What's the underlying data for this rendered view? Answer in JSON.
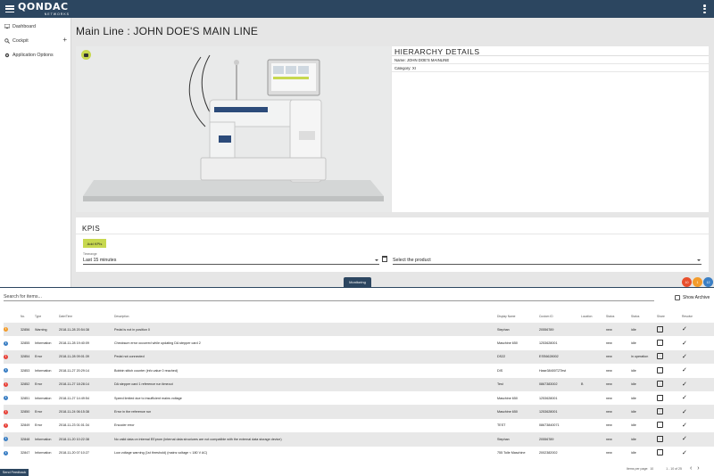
{
  "header": {
    "brand": "QONDAC",
    "brand_sub": "NETWORKS",
    "menu_icon": "hamburger-icon",
    "more_icon": "kebab-icon"
  },
  "sidebar": {
    "items": [
      {
        "label": "Dashboard",
        "icon": "dashboard-icon"
      },
      {
        "label": "Cockpit",
        "icon": "search-icon",
        "action_icon": "plus-icon"
      },
      {
        "label": "Application Options",
        "icon": "gear-icon"
      }
    ]
  },
  "main": {
    "title": "Main Line : JOHN DOE'S MAIN LINE"
  },
  "hierarchy": {
    "title": "HIERARCHY DETAILS",
    "name": "Name: JOHN DOE'S MAINLINE",
    "category": "Category: XI"
  },
  "kpis": {
    "title": "KPIS",
    "add_label": "Add KPIs",
    "timerange_label": "Timerange",
    "timerange_value": "Last 15 minutes",
    "product_placeholder": "Select the product"
  },
  "status_circles": [
    {
      "label": "10",
      "color": "#e84f2c"
    },
    {
      "label": "1",
      "color": "#f39c2b"
    },
    {
      "label": "12",
      "color": "#3b7fc4"
    }
  ],
  "monitoring": {
    "tab_label": "Monitoring",
    "search_placeholder": "Search for items...",
    "show_archive": "Show Archive",
    "columns": [
      "No.",
      "Type",
      "Date/Time",
      "Description",
      "Display Name",
      "Custom ID",
      "Location",
      "Status",
      "Status",
      "Share",
      "Resolve"
    ],
    "rows": [
      {
        "no": "32856",
        "type": "Warning",
        "dt": "2018-11-28 20:54:38",
        "desc": "Pedal is not in position 0",
        "name": "Stephan",
        "cid": "20556789",
        "loc": "",
        "s1": "new",
        "s2": "idle"
      },
      {
        "no": "32855",
        "type": "Information",
        "dt": "2018-11-28 19:40:09",
        "desc": "Checksum error occurred while updating DA stepper card 2",
        "name": "Maschine 650",
        "cid": "1253628001",
        "loc": "",
        "s1": "new",
        "s2": "idle"
      },
      {
        "no": "32854",
        "type": "Error",
        "dt": "2018-11-28 09:01:39",
        "desc": "Pedal not connected",
        "name": "DS22",
        "cid": "ESS6628002",
        "loc": "",
        "s1": "new",
        "s2": "in operation"
      },
      {
        "no": "32853",
        "type": "Information",
        "dt": "2018-11-27 20:29:14",
        "desc": "Bobbin stitch counter (info value 0 reached)",
        "name": "DIS",
        "cid": "Hase38400TZTest",
        "loc": "",
        "s1": "new",
        "s2": "idle"
      },
      {
        "no": "32852",
        "type": "Error",
        "dt": "2018-11-27 18:28:14",
        "desc": "DA stepper card 1 reference run timeout",
        "name": "Test",
        "cid": "0867383002",
        "loc": "B",
        "s1": "new",
        "s2": "idle"
      },
      {
        "no": "32851",
        "type": "Information",
        "dt": "2018-11-27 14:49:54",
        "desc": "Speed limited due to insufficient mains voltage",
        "name": "Maschine 650",
        "cid": "1253628001",
        "loc": "",
        "s1": "new",
        "s2": "idle"
      },
      {
        "no": "32850",
        "type": "Error",
        "dt": "2018-11-24 06:15:38",
        "desc": "Error in the reference run",
        "name": "Maschine 650",
        "cid": "1253628001",
        "loc": "",
        "s1": "new",
        "s2": "idle"
      },
      {
        "no": "32849",
        "type": "Error",
        "dt": "2018-11-23 01:01:34",
        "desc": "Encoder error",
        "name": "TEST",
        "cid": "08673840071",
        "loc": "",
        "s1": "new",
        "s2": "idle"
      },
      {
        "no": "32848",
        "type": "Information",
        "dt": "2018-11-20 10:22:38",
        "desc": "No valid data on internal EEprom (internal data structures are not compatible with the external data storage device)",
        "name": "Stephan",
        "cid": "20556789",
        "loc": "",
        "s1": "new",
        "s2": "idle"
      },
      {
        "no": "32847",
        "type": "Information",
        "dt": "2018-11-20 07:10:27",
        "desc": "Low voltage warning (1st threshold) (mains voltage < 180 V AC)",
        "name": "755 Tolle Maschine",
        "cid": "2002382002",
        "loc": "",
        "s1": "new",
        "s2": "idle"
      }
    ],
    "items_per_page_label": "Items per page:",
    "items_per_page": "10",
    "range": "1 - 10 of 25"
  },
  "feedback_label": "Send Feedback",
  "colors": {
    "primary": "#2c4660",
    "accent": "#c7d84f",
    "warning": "#f39c2b",
    "error": "#e8433a",
    "info": "#3b7fc4"
  }
}
